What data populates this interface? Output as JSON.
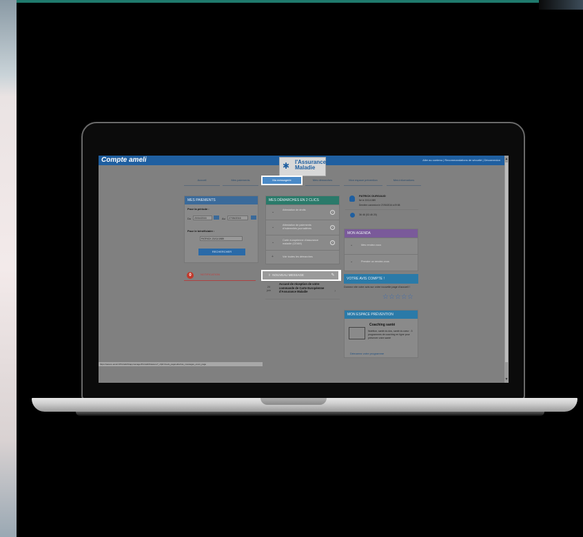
{
  "app": {
    "brand": "Compte ameli"
  },
  "toplinks": "Aller au contenu  |  Recommandations de sécurité  |  Déconnexion",
  "logo": {
    "line1": "l'Assurance",
    "line2": "Maladie"
  },
  "nav": {
    "tabs": [
      {
        "label": "Accueil",
        "active": false
      },
      {
        "label": "Mes paiements",
        "active": false
      },
      {
        "label": "Ma messagerie",
        "active": true
      },
      {
        "label": "Mes démarches",
        "active": false
      },
      {
        "label": "Mon espace prévention",
        "active": false
      },
      {
        "label": "Mes informations",
        "active": false
      }
    ]
  },
  "payments": {
    "title": "MES PAIEMENTS",
    "period_label": "Pour la période :",
    "from_label": "Du",
    "from_value": "20/04/2016",
    "to_label": "Au",
    "to_value": "27/06/2016",
    "beneficiary_label": "Pour le bénéficiaire :",
    "beneficiary_value": "PATRICK 20/11/1989",
    "search_button": "RECHERCHER"
  },
  "notification": {
    "badge": "0",
    "label": "NOTIFICATION"
  },
  "demarches": {
    "title": "MES DÉMARCHES EN 2 CLICS",
    "items": [
      {
        "label": "Attestation de droits"
      },
      {
        "label": "Attestation de paiements d'indemnités journalières"
      },
      {
        "label": "Carte européenne d'assurance maladie (CEAM)"
      }
    ],
    "all_link": "Voir toutes les démarches"
  },
  "messages": {
    "new_message": "NOUVEAU MESSAGE",
    "items": [
      {
        "date": "20 juin",
        "subject": "Accusé de réception de votre commande de Carte Européenne d'Assurance Maladie"
      }
    ]
  },
  "profile": {
    "name": "PATRICK DURGAUD",
    "born": "Né le 20/11/1989",
    "last_login": "Dernière connexion le 27/06/2016 à 09:58",
    "phone": "36 46 (02-46 20)"
  },
  "agenda": {
    "title": "MON AGENDA",
    "items": [
      {
        "label": "Mes rendez-vous"
      },
      {
        "label": "Prendre un rendez-vous"
      }
    ]
  },
  "feedback": {
    "title": "VOTRE AVIS COMPTE !",
    "text": "Donnez vite votre avis sur votre nouvelle page d'accueil !",
    "stars": "☆☆☆☆☆"
  },
  "prevention": {
    "title": "MON ESPACE PRÉVENTION",
    "card_title": "Coaching santé",
    "card_text": "Nutrition, santé du dos, santé du cœur : 3 programmes de coaching en ligne pour préserver votre santé",
    "card_link": "Démarrez votre programme"
  },
  "statusbar": "https://assure.ameli.fr/PortailAS/appmanager/PortailAS/assure?_nfpb=true&_pageLabel=as_messages_envoi_page",
  "colors": {
    "topbar": "#1f5fa0",
    "payments_header": "#3a6a9a",
    "demarches_header": "#2a7a6a",
    "agenda_header": "#7a5a9a",
    "feedback_header": "#2a7aa8",
    "notif": "#c0392b"
  }
}
